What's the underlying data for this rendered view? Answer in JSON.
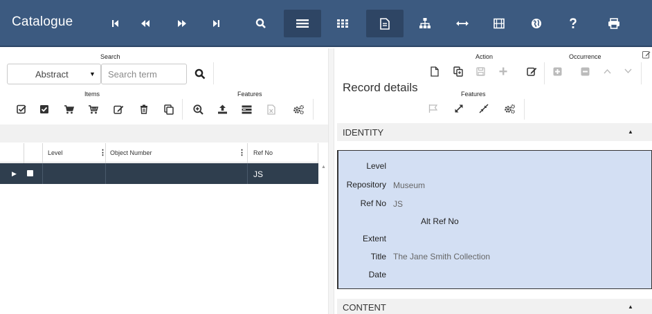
{
  "app": {
    "title": "Catalogue"
  },
  "nav": {
    "buttons": [
      {
        "name": "first-record-button",
        "icon": "first-icon"
      },
      {
        "name": "previous-record-button",
        "icon": "rewind-icon"
      },
      {
        "name": "next-record-button",
        "icon": "fast-forward-icon"
      },
      {
        "name": "last-record-button",
        "icon": "last-icon"
      },
      {
        "name": "search-button",
        "icon": "search-icon"
      },
      {
        "name": "list-view-button",
        "icon": "list-icon",
        "active": true
      },
      {
        "name": "grid-view-button",
        "icon": "grid-icon"
      },
      {
        "name": "record-view-button",
        "icon": "document-icon",
        "active": true
      },
      {
        "name": "hierarchy-button",
        "icon": "hierarchy-icon"
      },
      {
        "name": "expand-width-button",
        "icon": "arrows-horizontal-icon"
      },
      {
        "name": "media-button",
        "icon": "film-icon"
      },
      {
        "name": "globe-button",
        "icon": "globe-icon"
      },
      {
        "name": "help-button",
        "icon": "help-icon"
      },
      {
        "name": "print-button",
        "icon": "printer-icon"
      }
    ],
    "colors": {
      "bar": "#3c5a80",
      "active": "#2e4564"
    }
  },
  "search": {
    "group_label": "Search",
    "field_select": "Abstract",
    "term_placeholder": "Search term"
  },
  "items": {
    "group_label": "Items"
  },
  "features_left": {
    "group_label": "Features"
  },
  "grid": {
    "columns": [
      "Level",
      "Object Number",
      "Ref No"
    ],
    "rows": [
      {
        "level": "",
        "object_number": "",
        "ref_no": "JS"
      }
    ],
    "selected_row_color": "#2f3e4e"
  },
  "record": {
    "title": "Record details",
    "action_label": "Action",
    "occurrence_label": "Occurrence",
    "features_label": "Features"
  },
  "identity": {
    "section_title": "IDENTITY",
    "fields": {
      "level_label": "Level",
      "level_value": "",
      "repository_label": "Repository",
      "repository_value": "Museum",
      "refno_label": "Ref No",
      "refno_value": "JS",
      "altref_label": "Alt Ref No",
      "extent_label": "Extent",
      "extent_value": "",
      "title_label": "Title",
      "title_value": "The Jane Smith Collection",
      "date_label": "Date",
      "date_value": ""
    },
    "box_color": "#d3dff3"
  },
  "content": {
    "section_title": "CONTENT"
  }
}
